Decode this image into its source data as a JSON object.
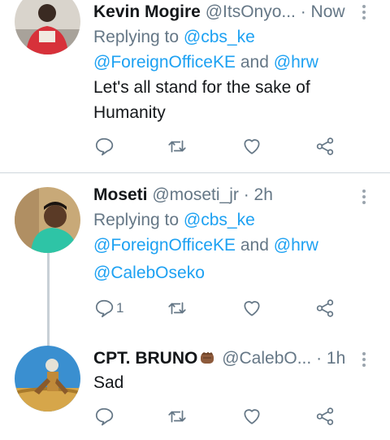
{
  "tweets": [
    {
      "name": "Kevin Mogire",
      "handle": "@ItsOnyo...",
      "time": "· Now",
      "replying_prefix": "Replying to",
      "replying_lines": [
        "@cbs_ke",
        "@ForeignOfficeKE",
        "and",
        "@hrw"
      ],
      "text_lines": [
        "Let's all stand for the sake of",
        "Humanity"
      ],
      "reply_count": ""
    },
    {
      "name": "Moseti",
      "handle": "@moseti_jr",
      "time": "· 2h",
      "replying_prefix": "Replying to",
      "replying_lines": [
        "@cbs_ke",
        "@ForeignOfficeKE",
        "and",
        "@hrw"
      ],
      "mention_line": "@CalebOseko",
      "reply_count": "1"
    },
    {
      "name": "CPT. BRUNO",
      "handle": "@CalebO...",
      "time": "· 1h",
      "text": "Sad",
      "reply_count": ""
    }
  ],
  "icons": {
    "reply": "reply-icon",
    "retweet": "retweet-icon",
    "like": "heart-icon",
    "share": "share-icon",
    "menu": "more-vertical-icon",
    "emoji": "raised-fist-emoji"
  },
  "colors": {
    "link": "#1da1f2",
    "secondary": "#657786",
    "icon": "#657786",
    "divider": "#cfd6dc"
  }
}
